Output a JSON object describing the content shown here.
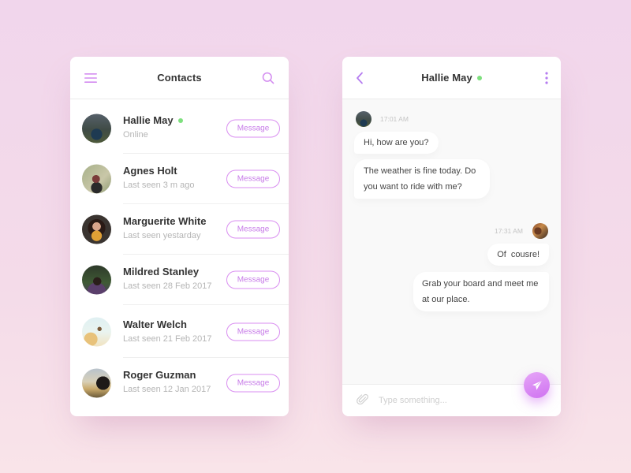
{
  "colors": {
    "accent": "#c77be8",
    "online": "#7ee07e",
    "title_text": "#333333",
    "muted_text": "#b5b5b5"
  },
  "contacts_panel": {
    "title": "Contacts",
    "menu_icon": "hamburger-menu-icon",
    "search_icon": "search-icon",
    "message_button_label": "Message",
    "contacts": [
      {
        "name": "Hallie May",
        "status": "Online",
        "online": true
      },
      {
        "name": "Agnes Holt",
        "status": "Last seen 3 m ago",
        "online": false
      },
      {
        "name": "Marguerite White",
        "status": "Last seen yestarday",
        "online": false
      },
      {
        "name": "Mildred Stanley",
        "status": "Last seen 28 Feb 2017",
        "online": false
      },
      {
        "name": "Walter Welch",
        "status": "Last seen 21 Feb 2017",
        "online": false
      },
      {
        "name": "Roger Guzman",
        "status": "Last seen 12 Jan 2017",
        "online": false
      }
    ]
  },
  "chat_panel": {
    "title": "Hallie May",
    "online": true,
    "back_icon": "chevron-left-icon",
    "more_icon": "more-vertical-icon",
    "messages": [
      {
        "direction": "incoming",
        "time": "17:01 AM",
        "bubbles": [
          "Hi, how are you?",
          "The weather is fine today. Do you want to ride with me?"
        ]
      },
      {
        "direction": "outgoing",
        "time": "17:31 AM",
        "bubbles": [
          "Of  cousre!",
          "Grab your board and meet me at our place."
        ]
      }
    ],
    "input": {
      "placeholder": "Type something...",
      "value": ""
    },
    "attach_icon": "paperclip-icon",
    "send_icon": "paper-plane-icon"
  }
}
